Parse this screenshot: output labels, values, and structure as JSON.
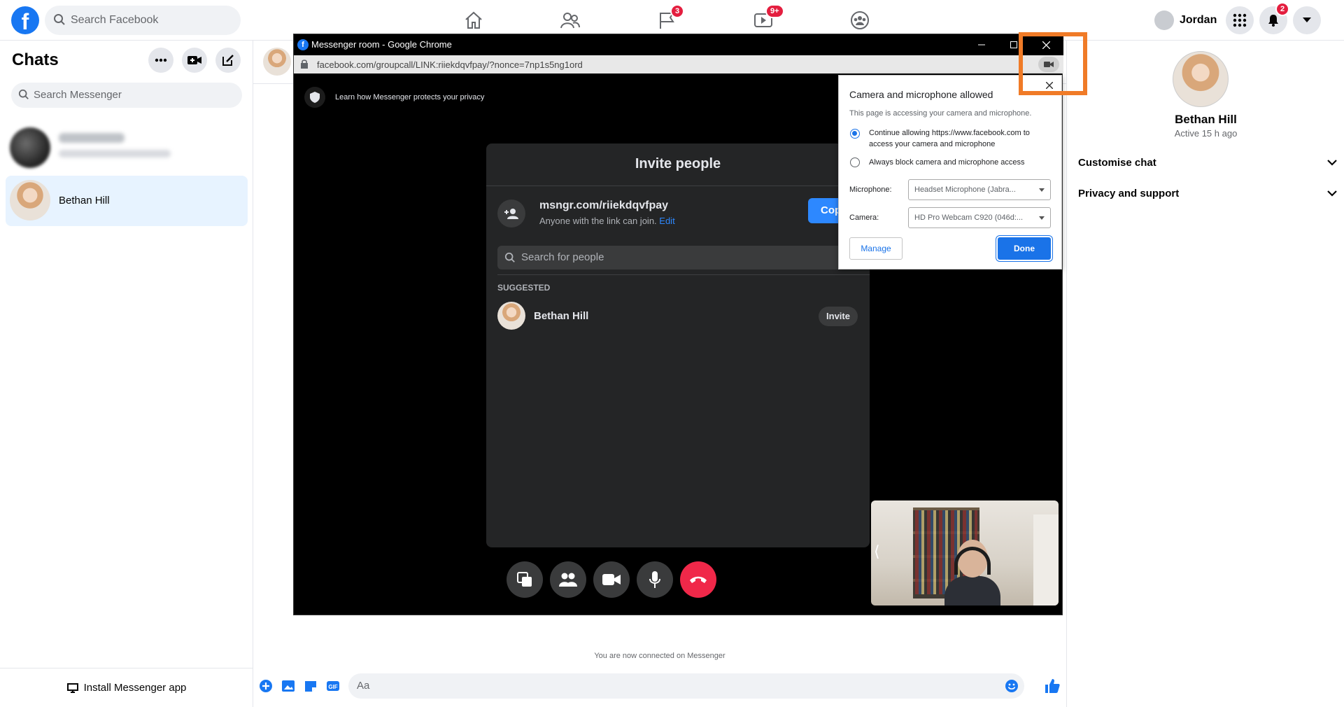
{
  "topbar": {
    "logo_letter": "f",
    "search_placeholder": "Search Facebook",
    "nav": [
      {
        "name": "home",
        "badge": ""
      },
      {
        "name": "friends",
        "badge": ""
      },
      {
        "name": "pages",
        "badge": "3"
      },
      {
        "name": "watch",
        "badge": "9+"
      },
      {
        "name": "groups",
        "badge": ""
      }
    ],
    "profile_name": "Jordan",
    "notification_count": "2"
  },
  "left": {
    "title": "Chats",
    "search_placeholder": "Search Messenger",
    "active_chat_name": "Bethan Hill",
    "install_label": "Install Messenger app"
  },
  "conversation": {
    "connected_text": "You are now connected on Messenger",
    "composer_placeholder": "Aa"
  },
  "right": {
    "name": "Bethan Hill",
    "active": "Active 15 h ago",
    "rows": [
      "Customise chat",
      "Privacy and support"
    ]
  },
  "popup": {
    "window_title": "Messenger room - Google Chrome",
    "url": "facebook.com/groupcall/LINK:riiekdqvfpay/?nonce=7np1s5ng1ord",
    "privacy_text": "Learn how Messenger protects your privacy",
    "invite": {
      "title": "Invite people",
      "link": "msngr.com/riiekdqvfpay",
      "link_desc": "Anyone with the link can join.",
      "edit_label": "Edit",
      "copy_label": "Cop",
      "search_placeholder": "Search for people",
      "suggested_label": "SUGGESTED",
      "suggested_name": "Bethan Hill",
      "invite_label": "Invite"
    }
  },
  "permission": {
    "title": "Camera and microphone allowed",
    "subtitle": "This page is accessing your camera and microphone.",
    "option_allow": "Continue allowing https://www.facebook.com to access your camera and microphone",
    "option_block": "Always block camera and microphone access",
    "selected": "allow",
    "microphone_label": "Microphone:",
    "microphone_value": "Headset Microphone (Jabra...",
    "camera_label": "Camera:",
    "camera_value": "HD Pro Webcam C920 (046d:...",
    "manage_label": "Manage",
    "done_label": "Done"
  },
  "colors": {
    "facebook_blue": "#1877f2",
    "chrome_blue": "#1a73e8",
    "badge_red": "#e41e3f",
    "end_call_red": "#f02849",
    "highlight_orange": "#f07b27"
  }
}
